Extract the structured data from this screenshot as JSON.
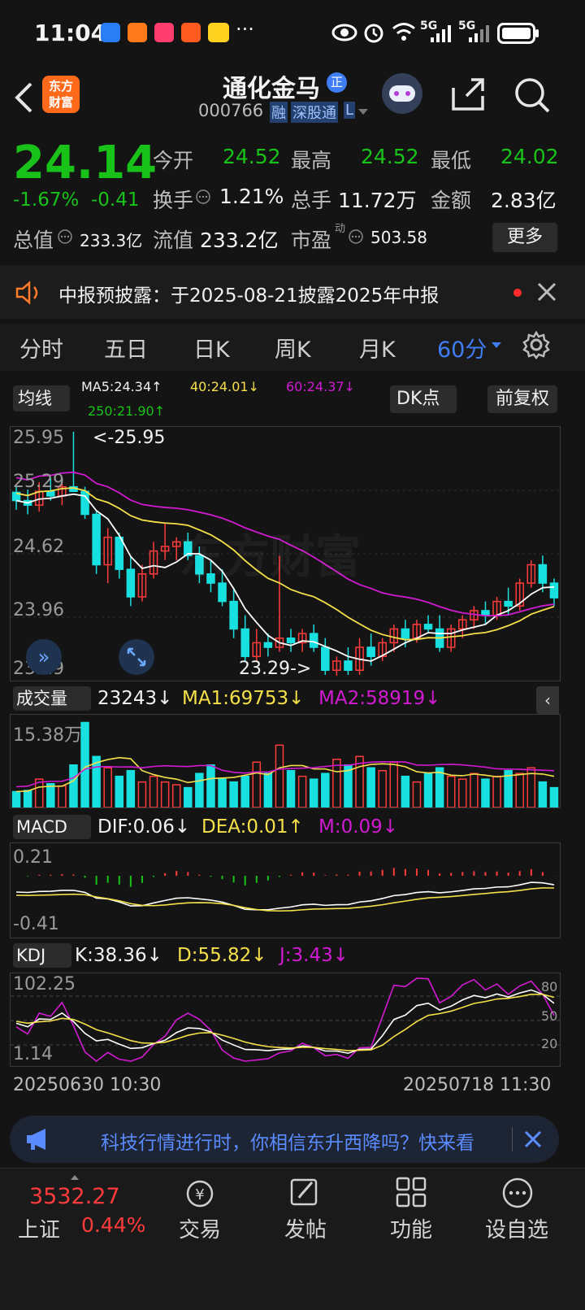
{
  "status": {
    "time": "11:04",
    "net1": "5G",
    "net2": "5G"
  },
  "header": {
    "title": "通化金马",
    "badge": "正",
    "code": "000766",
    "tag1": "融",
    "tag2": "深股通",
    "tag3": "L",
    "logo_line1": "东方",
    "logo_line2": "财富"
  },
  "quote": {
    "price": "24.14",
    "change_pct": "-1.67%",
    "change": "-0.41",
    "open_label": "今开",
    "open": "24.52",
    "high_label": "最高",
    "high": "24.52",
    "low_label": "最低",
    "low": "24.02",
    "turnover_label": "换手",
    "turnover": "1.21%",
    "volume_label": "总手",
    "volume": "11.72万",
    "amount_label": "金额",
    "amount": "2.83亿",
    "mcap_label": "总值",
    "mcap": "233.3亿",
    "float_label": "流值",
    "float": "233.2亿",
    "pe_label": "市盈",
    "pe_sup": "动",
    "pe": "503.58",
    "more_button": "更多"
  },
  "notice": {
    "text": "中报预披露：于2025-08-21披露2025年中报"
  },
  "tabs": [
    "分时",
    "五日",
    "日K",
    "周K",
    "月K",
    "60分"
  ],
  "kline": {
    "ma_button": "均线",
    "ma5": "MA5:24.34↑",
    "ma40": "40:24.01↓",
    "ma60": "60:24.37↓",
    "ma250": "250:21.90↑",
    "dk_button": "DK点",
    "fq_button": "前复权",
    "y_labels": [
      "25.95",
      "25.29",
      "24.62",
      "23.96",
      "23.29"
    ],
    "high_mark": "<-25.95",
    "low_mark": "23.29->",
    "watermark": "东方财富"
  },
  "volume": {
    "button": "成交量",
    "vol": "23243↓",
    "ma1": "MA1:69753↓",
    "ma2": "MA2:58919↓",
    "y_label": "15.38万"
  },
  "macd": {
    "button": "MACD",
    "dif": "DIF:0.06↓",
    "dea": "DEA:0.01↑",
    "m": "M:0.09↓",
    "y_top": "0.21",
    "y_bottom": "-0.41"
  },
  "kdj": {
    "button": "KDJ",
    "k": "K:38.36↓",
    "d": "D:55.82↓",
    "j": "J:3.43↓",
    "y_top": "102.25",
    "y_bottom": "1.14",
    "r80": "80",
    "r50": "50",
    "r20": "20"
  },
  "xaxis": {
    "start": "20250630 10:30",
    "end": "20250718 11:30"
  },
  "ad": {
    "text": "科技行情进行时，你相信东升西降吗？快来看"
  },
  "bottom": {
    "index_value": "3532.27",
    "index_name": "上证",
    "index_change": "0.44%",
    "nav": [
      "交易",
      "发帖",
      "功能",
      "设自选"
    ]
  },
  "colors": {
    "up": "#ff3b3b",
    "down": "#19c219",
    "cyan": "#18e0e0",
    "ma_yellow": "#f5e04a",
    "ma_magenta": "#d21ad2",
    "accent": "#3f7df5"
  },
  "chart_data": {
    "type": "candlestick",
    "ohlc": [
      [
        25.29,
        25.35,
        25.1,
        25.2
      ],
      [
        25.2,
        25.32,
        25.05,
        25.15
      ],
      [
        25.15,
        25.4,
        25.08,
        25.3
      ],
      [
        25.3,
        25.45,
        25.2,
        25.25
      ],
      [
        25.25,
        25.4,
        25.15,
        25.35
      ],
      [
        25.35,
        25.95,
        25.3,
        25.3
      ],
      [
        25.3,
        25.35,
        25.0,
        25.05
      ],
      [
        25.05,
        25.1,
        24.4,
        24.5
      ],
      [
        24.5,
        24.9,
        24.3,
        24.8
      ],
      [
        24.8,
        24.85,
        24.35,
        24.45
      ],
      [
        24.45,
        24.6,
        24.05,
        24.15
      ],
      [
        24.15,
        24.5,
        24.1,
        24.4
      ],
      [
        24.4,
        24.75,
        24.35,
        24.65
      ],
      [
        24.65,
        24.95,
        24.55,
        24.7
      ],
      [
        24.7,
        24.8,
        24.55,
        24.75
      ],
      [
        24.75,
        24.85,
        24.55,
        24.6
      ],
      [
        24.6,
        24.7,
        24.3,
        24.4
      ],
      [
        24.4,
        24.55,
        24.2,
        24.3
      ],
      [
        24.3,
        24.45,
        24.05,
        24.1
      ],
      [
        24.1,
        24.25,
        23.7,
        23.8
      ],
      [
        23.8,
        23.95,
        23.45,
        23.5
      ],
      [
        23.5,
        23.8,
        23.45,
        23.65
      ],
      [
        23.65,
        23.75,
        23.5,
        23.6
      ],
      [
        23.6,
        24.6,
        23.55,
        23.7
      ],
      [
        23.7,
        23.8,
        23.55,
        23.65
      ],
      [
        23.65,
        23.8,
        23.55,
        23.75
      ],
      [
        23.75,
        23.85,
        23.55,
        23.6
      ],
      [
        23.6,
        23.7,
        23.3,
        23.35
      ],
      [
        23.35,
        23.5,
        23.29,
        23.45
      ],
      [
        23.45,
        23.6,
        23.3,
        23.35
      ],
      [
        23.35,
        23.7,
        23.3,
        23.6
      ],
      [
        23.6,
        23.75,
        23.4,
        23.5
      ],
      [
        23.5,
        23.7,
        23.45,
        23.65
      ],
      [
        23.65,
        23.85,
        23.55,
        23.8
      ],
      [
        23.8,
        23.9,
        23.6,
        23.7
      ],
      [
        23.7,
        23.9,
        23.65,
        23.85
      ],
      [
        23.85,
        23.95,
        23.75,
        23.8
      ],
      [
        23.8,
        23.95,
        23.55,
        23.6
      ],
      [
        23.6,
        23.85,
        23.55,
        23.8
      ],
      [
        23.8,
        23.95,
        23.7,
        23.9
      ],
      [
        23.9,
        24.05,
        23.8,
        24.0
      ],
      [
        24.0,
        24.1,
        23.85,
        23.95
      ],
      [
        23.95,
        24.15,
        23.9,
        24.1
      ],
      [
        24.1,
        24.25,
        23.95,
        24.05
      ],
      [
        24.05,
        24.35,
        24.0,
        24.3
      ],
      [
        24.3,
        24.55,
        24.25,
        24.5
      ],
      [
        24.5,
        24.6,
        24.2,
        24.3
      ],
      [
        24.3,
        24.35,
        24.05,
        24.14
      ]
    ],
    "volume": [
      28,
      30,
      50,
      42,
      38,
      75,
      150,
      90,
      70,
      55,
      65,
      45,
      55,
      45,
      40,
      35,
      60,
      75,
      50,
      45,
      55,
      80,
      60,
      110,
      65,
      55,
      50,
      60,
      85,
      75,
      90,
      70,
      65,
      80,
      55,
      45,
      60,
      70,
      55,
      50,
      60,
      50,
      55,
      65,
      60,
      70,
      45,
      35
    ],
    "ylim": [
      23.29,
      25.95
    ]
  }
}
